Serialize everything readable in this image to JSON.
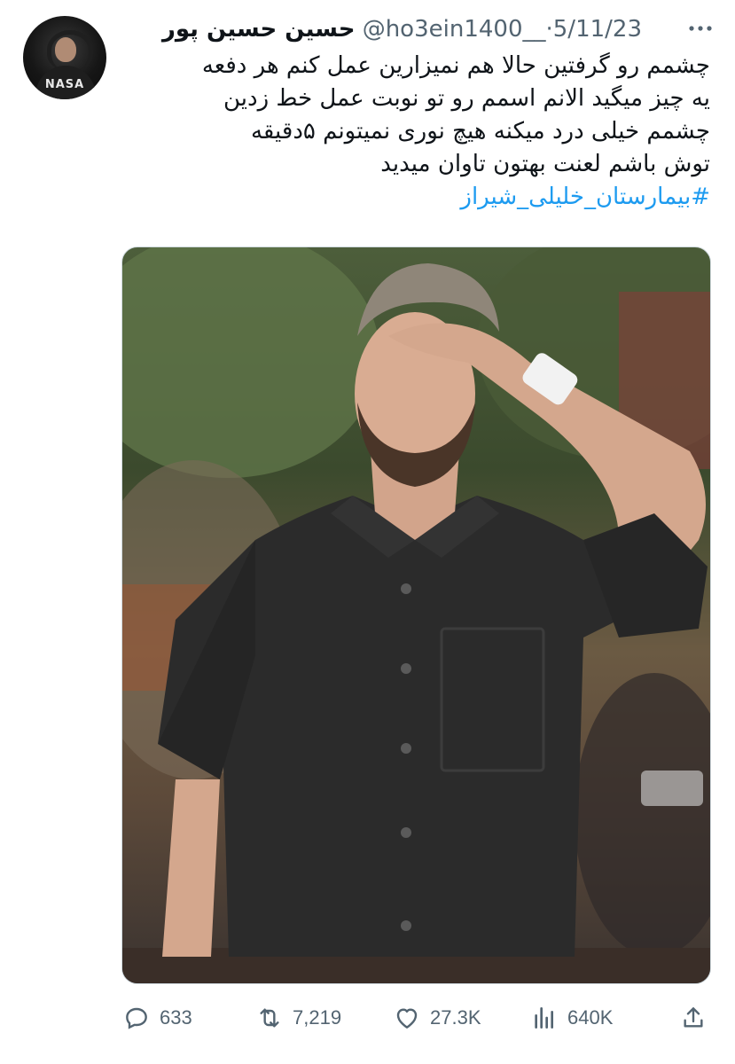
{
  "tweet": {
    "display_name": "حسین حسین پور",
    "handle": "@ho3ein1400__",
    "separator": "·",
    "date": "5/11/23",
    "text_lines": [
      "چشمم رو گرفتین حالا هم نمیزارین عمل کنم هر دفعه",
      "یه چیز میگید الانم اسمم رو تو نوبت عمل خط زدین",
      "چشمم خیلی درد میکنه هیچ نوری نمیتونم ۵دقیقه",
      "توش باشم لعنت بهتون تاوان میدید"
    ],
    "hashtag": "#بیمارستان_خلیلی_شیراز",
    "avatar_text": "NASA"
  },
  "actions": {
    "reply": {
      "icon": "reply-icon",
      "count": "633"
    },
    "retweet": {
      "icon": "retweet-icon",
      "count": "7,219"
    },
    "like": {
      "icon": "heart-icon",
      "count": "27.3K"
    },
    "views": {
      "icon": "views-icon",
      "count": "640K"
    },
    "share": {
      "icon": "share-icon"
    }
  },
  "colors": {
    "link": "#1d9bf0",
    "muted": "#536471",
    "text": "#0f1419"
  }
}
